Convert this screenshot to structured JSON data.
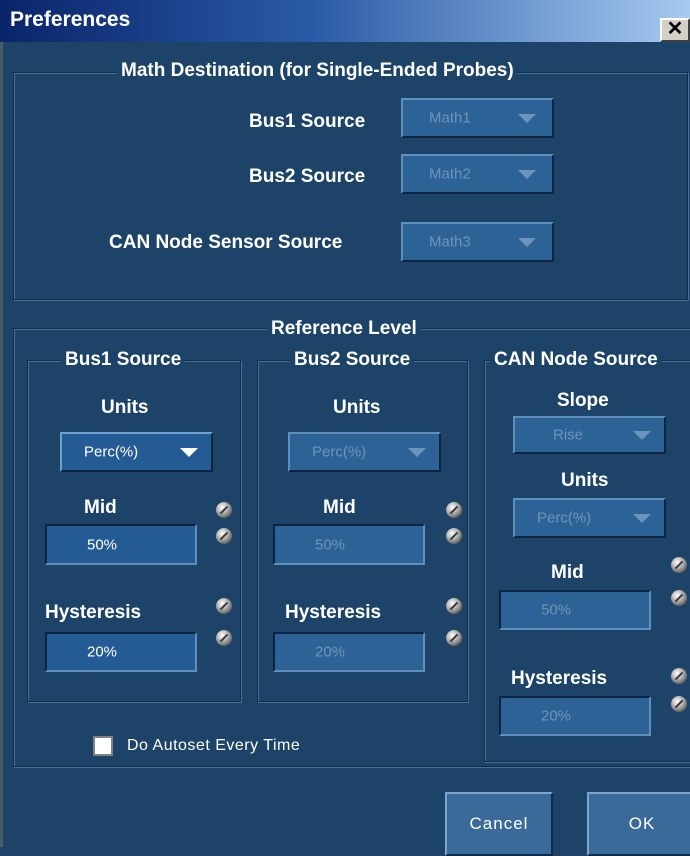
{
  "window": {
    "title": "Preferences",
    "close_glyph": "✕"
  },
  "math_destination": {
    "title": "Math Destination (for Single-Ended Probes)",
    "bus1": {
      "label": "Bus1 Source",
      "value": "Math1"
    },
    "bus2": {
      "label": "Bus2 Source",
      "value": "Math2"
    },
    "can": {
      "label": "CAN Node Sensor Source",
      "value": "Math3"
    }
  },
  "reference_level": {
    "title": "Reference Level",
    "bus1": {
      "title": "Bus1 Source",
      "units_label": "Units",
      "units_value": "Perc(%)",
      "mid_label": "Mid",
      "mid_value": "50%",
      "hyst_label": "Hysteresis",
      "hyst_value": "20%"
    },
    "bus2": {
      "title": "Bus2 Source",
      "units_label": "Units",
      "units_value": "Perc(%)",
      "mid_label": "Mid",
      "mid_value": "50%",
      "hyst_label": "Hysteresis",
      "hyst_value": "20%"
    },
    "can": {
      "title": "CAN Node Source",
      "slope_label": "Slope",
      "slope_value": "Rise",
      "units_label": "Units",
      "units_value": "Perc(%)",
      "mid_label": "Mid",
      "mid_value": "50%",
      "hyst_label": "Hysteresis",
      "hyst_value": "20%"
    }
  },
  "autoset": {
    "label": "Do Autoset Every Time",
    "checked": false
  },
  "buttons": {
    "cancel": "Cancel",
    "ok": "OK"
  },
  "colors": {
    "background": "#1d4468",
    "title_bar": "#0a246a",
    "disabled_text": "#6d95bb"
  },
  "icons": {
    "knob": "adjust-knob-icon",
    "dropdown": "chevron-down-icon",
    "close": "close-icon"
  }
}
